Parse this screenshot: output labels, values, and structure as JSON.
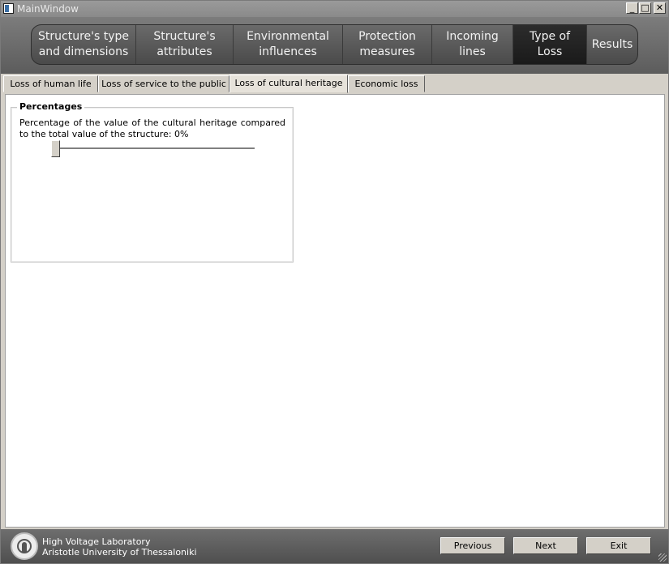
{
  "window": {
    "title": "MainWindow",
    "controls": {
      "minimize": "_",
      "maximize": "□",
      "close": "✕"
    }
  },
  "nav": {
    "items": [
      {
        "label": "Structure's type and dimensions",
        "line1": "Structure's type",
        "line2": "and dimensions"
      },
      {
        "label": "Structure's attributes",
        "line1": "Structure's",
        "line2": "attributes"
      },
      {
        "label": "Environmental influences",
        "line1": "Environmental",
        "line2": "influences"
      },
      {
        "label": "Protection measures",
        "line1": "Protection",
        "line2": "measures"
      },
      {
        "label": "Incoming lines",
        "line1": "Incoming",
        "line2": "lines"
      },
      {
        "label": "Type of Loss",
        "line1": "Type of",
        "line2": "Loss"
      },
      {
        "label": "Results",
        "line1": "Results",
        "line2": ""
      }
    ],
    "active_index": 5
  },
  "subtabs": {
    "items": [
      "Loss of human life",
      "Loss of service to the public",
      "Loss of cultural heritage",
      "Economic loss"
    ],
    "active_index": 2
  },
  "group": {
    "title": "Percentages",
    "description": "Percentage of the value of the cultural heritage compared to the total value of the structure: 0%",
    "slider_value": 0
  },
  "footer": {
    "lab_name": "High Voltage Laboratory",
    "university": "Aristotle University of Thessaloniki",
    "previous_label": "Previous",
    "next_label": "Next",
    "exit_label": "Exit"
  },
  "colors": {
    "nav_active": "#1f1f1f",
    "nav_bg": "#5a5a5a",
    "window_bg": "#d4d0c8"
  }
}
